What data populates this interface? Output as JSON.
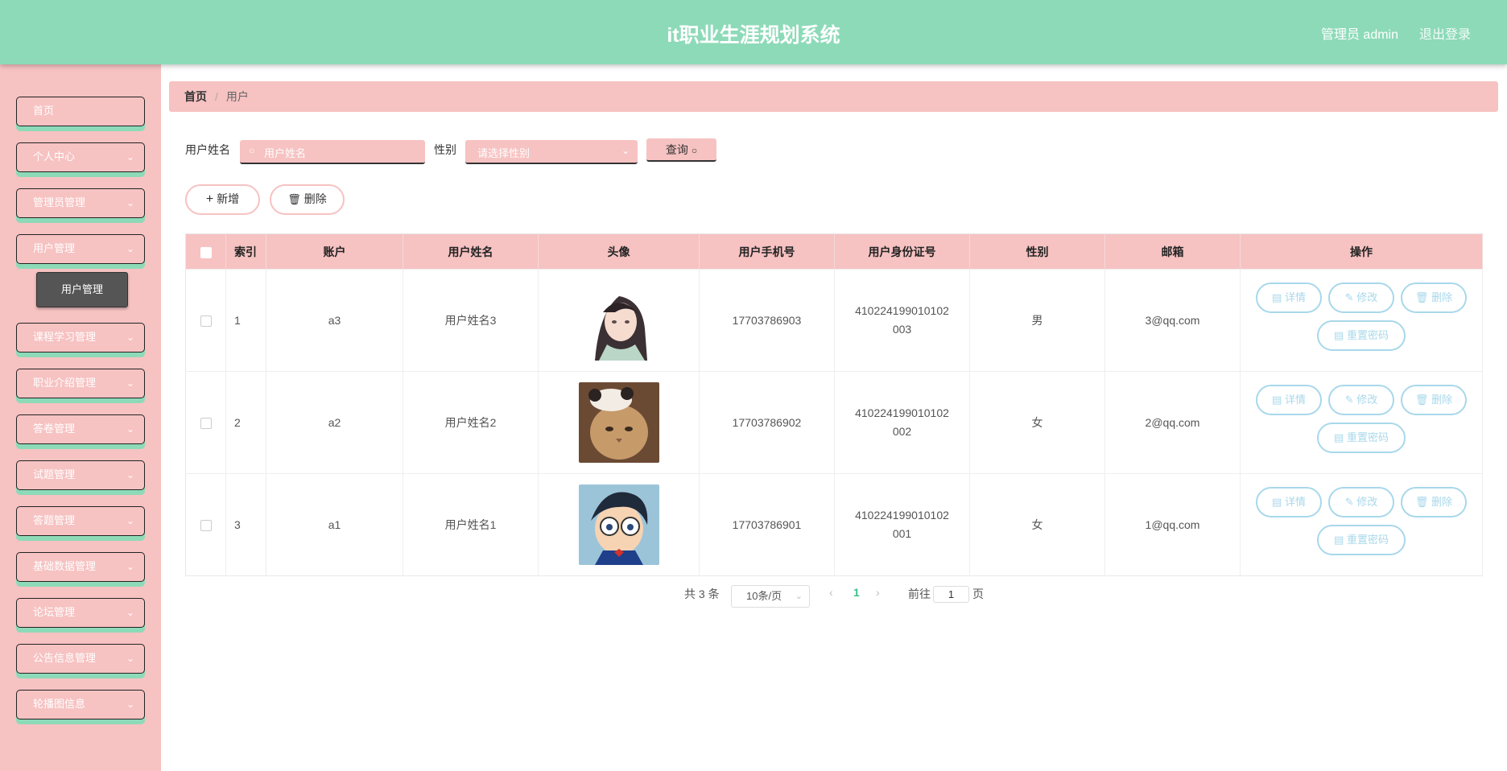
{
  "header": {
    "title": "it职业生涯规划系统",
    "user": "管理员 admin",
    "logout": "退出登录"
  },
  "sidebar": {
    "items": [
      {
        "label": "首页",
        "has_children": false
      },
      {
        "label": "个人中心",
        "has_children": true
      },
      {
        "label": "管理员管理",
        "has_children": true
      },
      {
        "label": "用户管理",
        "has_children": true
      },
      {
        "label": "课程学习管理",
        "has_children": true
      },
      {
        "label": "职业介绍管理",
        "has_children": true
      },
      {
        "label": "答卷管理",
        "has_children": true
      },
      {
        "label": "试题管理",
        "has_children": true
      },
      {
        "label": "答题管理",
        "has_children": true
      },
      {
        "label": "基础数据管理",
        "has_children": true
      },
      {
        "label": "论坛管理",
        "has_children": true
      },
      {
        "label": "公告信息管理",
        "has_children": true
      },
      {
        "label": "轮播图信息",
        "has_children": true
      }
    ],
    "sub_item": "用户管理"
  },
  "breadcrumb": {
    "home": "首页",
    "separator": "/",
    "current": "用户"
  },
  "search": {
    "name_label": "用户姓名",
    "name_placeholder": "用户姓名",
    "gender_label": "性别",
    "gender_placeholder": "请选择性别",
    "query_label": "查询"
  },
  "actions": {
    "add_label": "新增",
    "delete_label": "删除"
  },
  "table": {
    "headers": [
      "索引",
      "账户",
      "用户姓名",
      "头像",
      "用户手机号",
      "用户身份证号",
      "性别",
      "邮箱",
      "操作"
    ],
    "rows": [
      {
        "index": "1",
        "account": "a3",
        "name": "用户姓名3",
        "avatar": "anime-girl-avatar",
        "phone": "17703786903",
        "idcard": "410224199010102003",
        "gender": "男",
        "email": "3@qq.com"
      },
      {
        "index": "2",
        "account": "a2",
        "name": "用户姓名2",
        "avatar": "cat-avatar",
        "phone": "17703786902",
        "idcard": "410224199010102002",
        "gender": "女",
        "email": "2@qq.com"
      },
      {
        "index": "3",
        "account": "a1",
        "name": "用户姓名1",
        "avatar": "cartoon-boy-avatar",
        "phone": "17703786901",
        "idcard": "410224199010102001",
        "gender": "女",
        "email": "1@qq.com"
      }
    ],
    "row_ops": {
      "detail": "详情",
      "edit": "修改",
      "delete": "删除",
      "reset": "重置密码"
    }
  },
  "pagination": {
    "total": "共 3 条",
    "page_size": "10条/页",
    "current_page": "1",
    "goto_label": "前往",
    "goto_value": "1",
    "page_suffix": "页"
  },
  "colors": {
    "header": "#8ddab8",
    "sidebar": "#f7c2c2",
    "accent_blue": "#a8d8ea"
  }
}
